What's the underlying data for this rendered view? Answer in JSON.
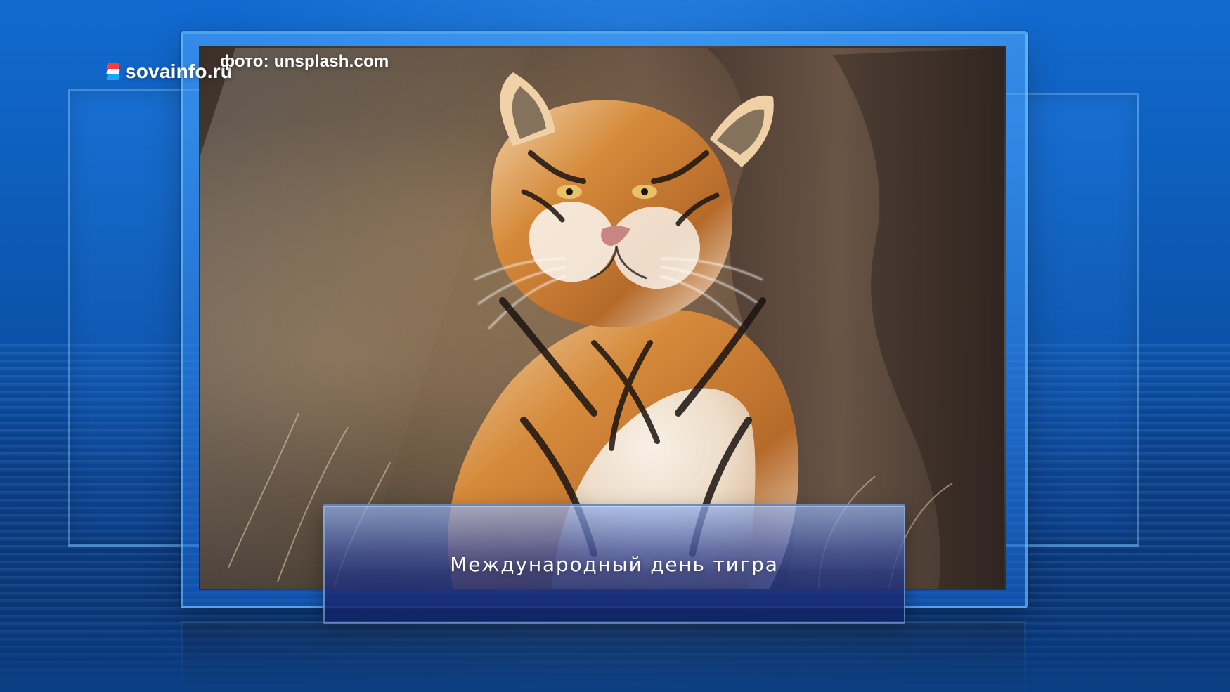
{
  "watermark": {
    "site": "sovainfo.ru",
    "photo_credit": "фото: unsplash.com"
  },
  "caption": {
    "text": "Международный день тигра"
  },
  "colors": {
    "background_blue": "#0a3f86",
    "frame_blue": "#1e7ae3",
    "caption_dark": "#0f1e5f"
  }
}
